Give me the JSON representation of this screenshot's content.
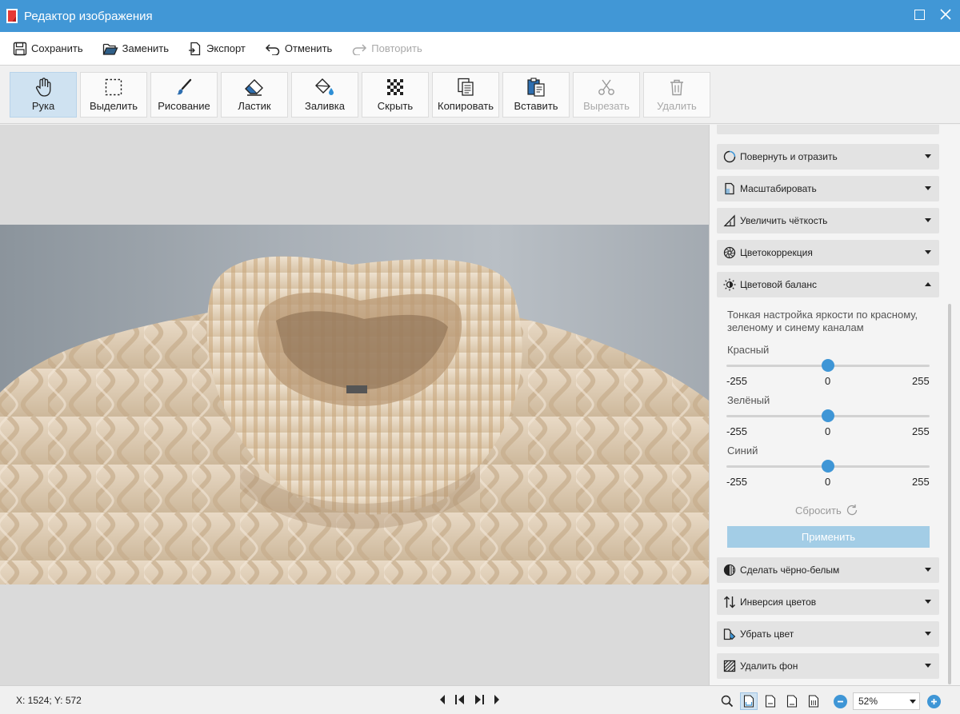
{
  "window": {
    "title": "Редактор изображения"
  },
  "menu": {
    "save": "Сохранить",
    "replace": "Заменить",
    "export": "Экспорт",
    "undo": "Отменить",
    "redo": "Повторить"
  },
  "tools": {
    "hand": "Рука",
    "select": "Выделить",
    "draw": "Рисование",
    "eraser": "Ластик",
    "fill": "Заливка",
    "hide": "Скрыть",
    "copy": "Копировать",
    "paste": "Вставить",
    "cut": "Вырезать",
    "delete": "Удалить"
  },
  "panel": {
    "rotate": "Повернуть и отразить",
    "scale": "Масштабировать",
    "sharpen": "Увеличить чёткость",
    "color_correction": "Цветокоррекция",
    "color_balance": {
      "title": "Цветовой баланс",
      "description": "Тонкая настройка яркости по красному, зеленому и синему каналам",
      "sliders": [
        {
          "label": "Красный",
          "min": "-255",
          "mid": "0",
          "max": "255",
          "value": 0
        },
        {
          "label": "Зелёный",
          "min": "-255",
          "mid": "0",
          "max": "255",
          "value": 0
        },
        {
          "label": "Синий",
          "min": "-255",
          "mid": "0",
          "max": "255",
          "value": 0
        }
      ],
      "reset": "Сбросить",
      "apply": "Применить"
    },
    "grayscale": "Сделать чёрно-белым",
    "invert": "Инверсия цветов",
    "remove_color": "Убрать цвет",
    "remove_bg": "Удалить фон"
  },
  "status": {
    "coords": "X: 1524; Y: 572",
    "zoom": "52%"
  },
  "colors": {
    "titlebar": "#4197d6",
    "accent": "#3f96d6",
    "active_tool": "#cfe2f1",
    "apply_button": "#a3cde6"
  }
}
